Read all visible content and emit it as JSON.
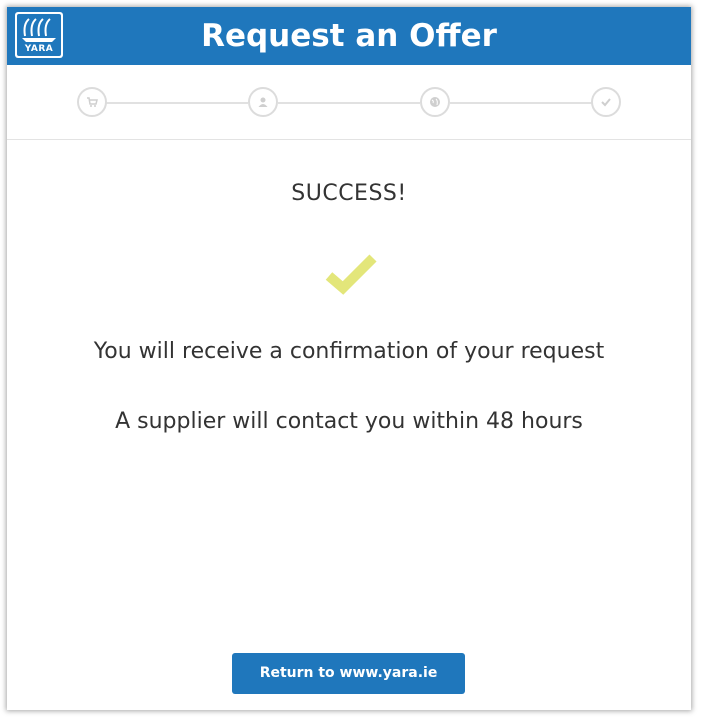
{
  "header": {
    "logo_text": "YARA",
    "title": "Request an Offer"
  },
  "progress": {
    "steps": [
      {
        "icon": "cart-icon"
      },
      {
        "icon": "user-icon"
      },
      {
        "icon": "globe-icon"
      },
      {
        "icon": "check-icon"
      }
    ]
  },
  "main": {
    "status": "SUCCESS!",
    "status_icon": "checkmark-icon",
    "checkmark_color": "#e3e67a",
    "message_1": "You will receive a confirmation of your request",
    "message_2": "A supplier will contact you within 48 hours"
  },
  "footer": {
    "return_button_label": "Return to www.yara.ie"
  },
  "colors": {
    "brand": "#1f77bc",
    "step_border": "#dcdcdc"
  }
}
